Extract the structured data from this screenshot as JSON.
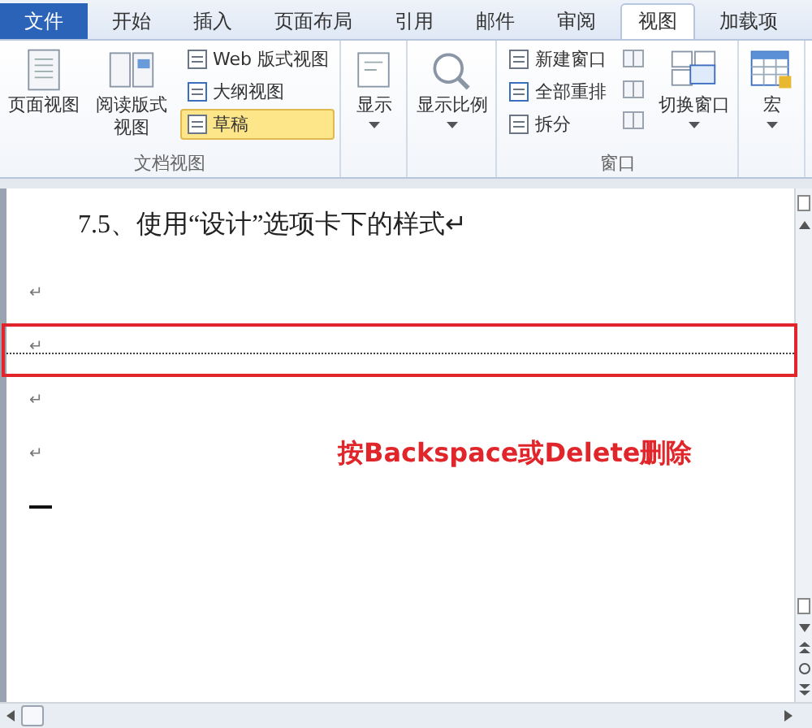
{
  "tabs": [
    {
      "label": "文件",
      "kind": "file",
      "selected": false
    },
    {
      "label": "开始",
      "kind": "tab",
      "selected": false
    },
    {
      "label": "插入",
      "kind": "tab",
      "selected": false
    },
    {
      "label": "页面布局",
      "kind": "tab",
      "selected": false
    },
    {
      "label": "引用",
      "kind": "tab",
      "selected": false
    },
    {
      "label": "邮件",
      "kind": "tab",
      "selected": false
    },
    {
      "label": "审阅",
      "kind": "tab",
      "selected": false
    },
    {
      "label": "视图",
      "kind": "tab",
      "selected": true
    },
    {
      "label": "加载项",
      "kind": "tab",
      "selected": false
    }
  ],
  "ribbon": {
    "groups": [
      {
        "label": "文档视图",
        "items": [
          {
            "kind": "large",
            "label": "页面视图",
            "dropdown": false,
            "selected": false
          },
          {
            "kind": "large",
            "label": "阅读版式视图",
            "dropdown": false,
            "selected": false
          },
          {
            "kind": "small",
            "label": "Web 版式视图",
            "selected": false
          },
          {
            "kind": "small",
            "label": "大纲视图",
            "selected": false
          },
          {
            "kind": "small",
            "label": "草稿",
            "selected": true
          }
        ]
      },
      {
        "items": [
          {
            "kind": "large",
            "label": "显示",
            "dropdown": true,
            "selected": false
          }
        ]
      },
      {
        "items": [
          {
            "kind": "large",
            "label": "显示比例",
            "dropdown": true,
            "selected": false
          }
        ]
      },
      {
        "label": "窗口",
        "items": [
          {
            "kind": "small",
            "label": "新建窗口",
            "selected": false
          },
          {
            "kind": "small",
            "label": "全部重排",
            "selected": false
          },
          {
            "kind": "small",
            "label": "拆分",
            "selected": false
          },
          {
            "kind": "icon"
          },
          {
            "kind": "icon"
          },
          {
            "kind": "icon"
          },
          {
            "kind": "large",
            "label": "切换窗口",
            "dropdown": true,
            "selected": false
          }
        ]
      },
      {
        "items": [
          {
            "kind": "large",
            "label": "宏",
            "dropdown": true,
            "selected": false
          }
        ]
      }
    ]
  },
  "document": {
    "heading": "7.5、使用“设计”选项卡下的样式↵",
    "lines": [
      {
        "kind": "mark",
        "text": "↵"
      },
      {
        "kind": "mark",
        "text": "↵",
        "highlighted": true
      },
      {
        "kind": "mark",
        "text": "↵"
      },
      {
        "kind": "mark",
        "text": "↵"
      },
      {
        "kind": "cursor"
      }
    ],
    "annotation": "按Backspace或Delete删除"
  }
}
